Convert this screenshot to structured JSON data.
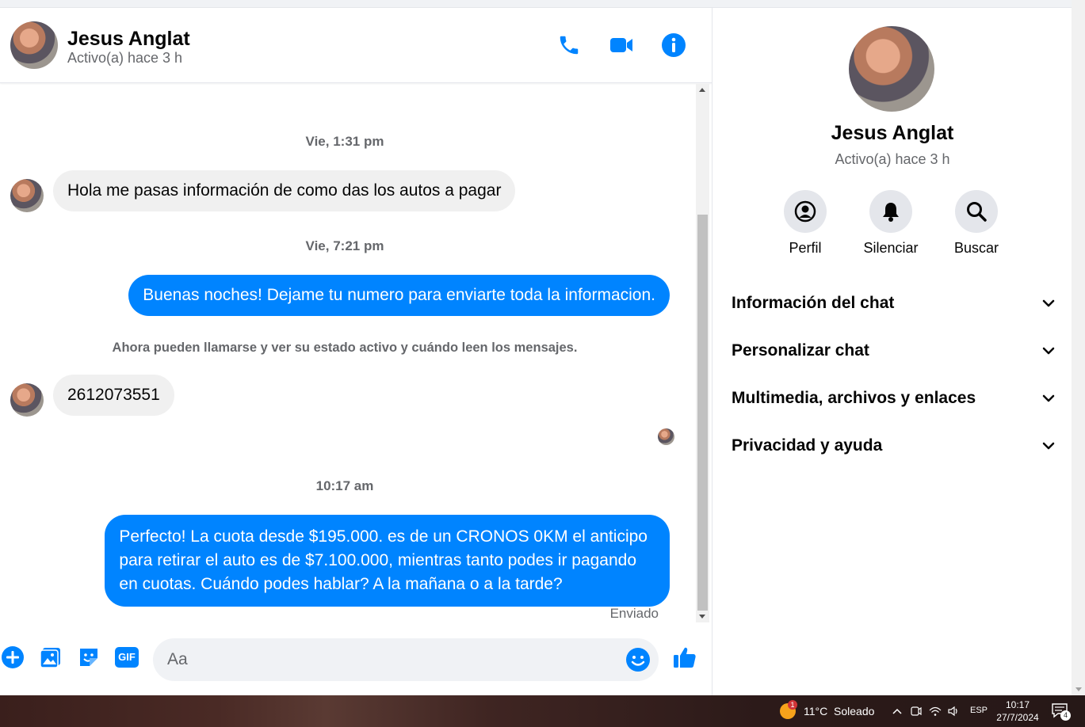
{
  "contact": {
    "name": "Jesus Anglat",
    "status": "Activo(a) hace 3 h"
  },
  "header_icons": [
    "phone-icon",
    "video-camera-icon",
    "info-icon"
  ],
  "messages": {
    "ts1": "Vie, 1:31 pm",
    "msg1": "Hola me pasas información de como das los autos a pagar",
    "ts2": "Vie, 7:21 pm",
    "msg2": "Buenas noches! Dejame tu numero para enviarte toda la informacion.",
    "system": "Ahora pueden llamarse y ver su estado activo y cuándo leen los mensajes.",
    "msg3": "2612073551",
    "ts3": "10:17 am",
    "msg4_line1": "Perfecto! La cuota desde $195.000. es de un CRONOS 0KM el anticipo",
    "msg4_line2": "para retirar el auto es de $7.100.000, mientras tanto podes ir pagando",
    "msg4_line3": "en cuotas. Cuándo podes hablar? A la mañana o a la tarde?",
    "sent_status": "Enviado"
  },
  "composer": {
    "placeholder": "Aa",
    "icons": [
      "plus-icon",
      "image-icon",
      "sticker-icon",
      "gif-icon",
      "emoji-icon",
      "like-icon"
    ],
    "gif_label": "GIF"
  },
  "panel": {
    "name": "Jesus Anglat",
    "status": "Activo(a) hace 3 h",
    "actions": [
      {
        "label": "Perfil",
        "icon": "profile-icon"
      },
      {
        "label": "Silenciar",
        "icon": "bell-icon"
      },
      {
        "label": "Buscar",
        "icon": "search-icon"
      }
    ],
    "sections": [
      "Información del chat",
      "Personalizar chat",
      "Multimedia, archivos y enlaces",
      "Privacidad y ayuda"
    ]
  },
  "taskbar": {
    "weather_badge": "1",
    "weather": "11°C  Soleado",
    "lang": "ESP",
    "time": "10:17",
    "date": "27/7/2024",
    "notif_count": "4"
  },
  "colors": {
    "accent": "#0084ff",
    "incoming_bubble": "#f0f0f0",
    "secondary_text": "#65676b"
  }
}
